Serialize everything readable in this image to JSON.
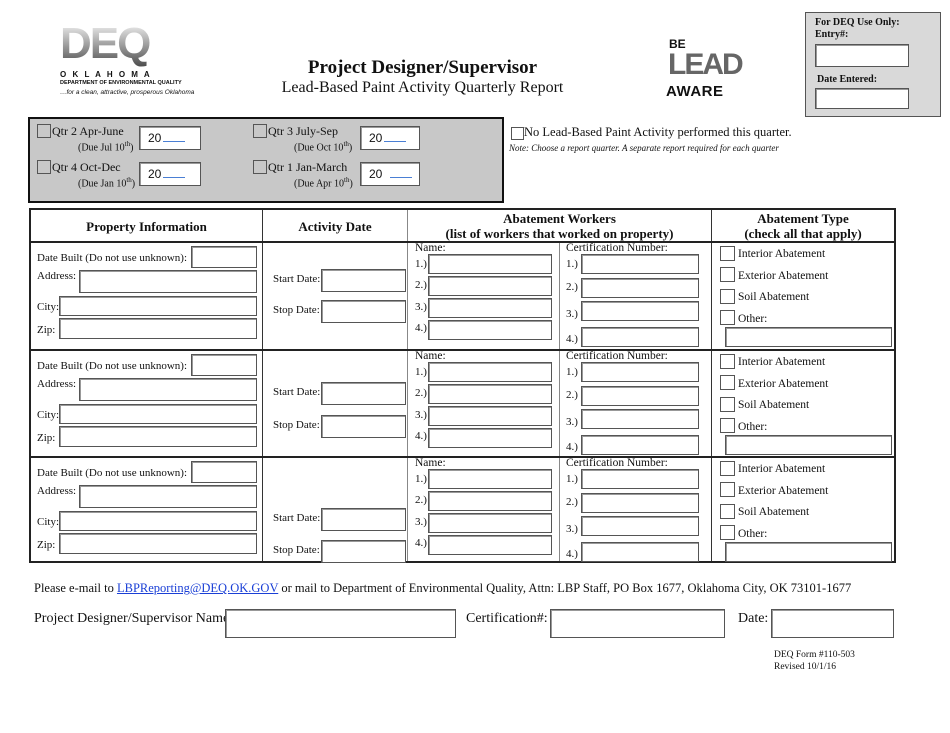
{
  "logos": {
    "deq": {
      "letters": "DEQ",
      "state": "O K L A H O M A",
      "dept": "DEPARTMENT OF ENVIRONMENTAL QUALITY",
      "tagline": "…for a clean, attractive, prosperous Oklahoma"
    },
    "lead": {
      "top": "BE",
      "middle": "LEAD",
      "bottom": "AWARE"
    }
  },
  "header": {
    "title": "Project Designer/Supervisor",
    "subtitle": "Lead-Based Paint Activity Quarterly Report"
  },
  "deq_use": {
    "heading": "For DEQ Use Only:",
    "entry_label": "Entry#:",
    "date_label": "Date Entered:"
  },
  "quarters": [
    {
      "label": "Qtr 2 Apr-June",
      "due": "(Due Jul 10",
      "due_sup": "th",
      "year_prefix": "20"
    },
    {
      "label": "Qtr 3 July-Sep",
      "due": "(Due Oct 10",
      "due_sup": "th",
      "year_prefix": "20"
    },
    {
      "label": "Qtr 4 Oct-Dec",
      "due": "(Due Jan 10",
      "due_sup": "th",
      "year_prefix": "20"
    },
    {
      "label": "Qtr 1 Jan-March",
      "due": "(Due Apr 10",
      "due_sup": "th",
      "year_prefix": "20"
    }
  ],
  "no_activity": {
    "label": "No Lead-Based Paint Activity performed this quarter.",
    "note": "Note: Choose a report quarter. A separate report required for each quarter"
  },
  "table": {
    "headers": {
      "property": "Property Information",
      "activity": "Activity Date",
      "workers_line1": "Abatement Workers",
      "workers_line2": "(list of workers that worked on property)",
      "type_line1": "Abatement Type",
      "type_line2": "(check all that apply)"
    },
    "labels": {
      "date_built": "Date Built (Do not use unknown):",
      "address": "Address:",
      "city": "City:",
      "zip": "Zip:",
      "start_date": "Start Date:",
      "stop_date": "Stop Date:",
      "name": "Name:",
      "cert": "Certification Number:",
      "nums": [
        "1.)",
        "2.)",
        "3.)",
        "4.)"
      ],
      "types": [
        "Interior Abatement",
        "Exterior Abatement",
        "Soil Abatement",
        "Other:"
      ]
    }
  },
  "footer": {
    "mail_prefix": "Please e-mail to ",
    "email": "LBPReporting@DEQ.OK.GOV",
    "mail_suffix": " or mail to Department of Environmental Quality, Attn: LBP Staff, PO Box 1677, Oklahoma City, OK 73101-1677",
    "name_label": "Project Designer/Supervisor Name:",
    "cert_label": "Certification#:",
    "date_label": "Date:",
    "form_no": "DEQ Form #110-503",
    "revised": "Revised 10/1/16"
  },
  "colors": {
    "link": "#1a3fd6",
    "gray_panel": "#c8c8c8",
    "deq_panel": "#d9d9d9"
  }
}
